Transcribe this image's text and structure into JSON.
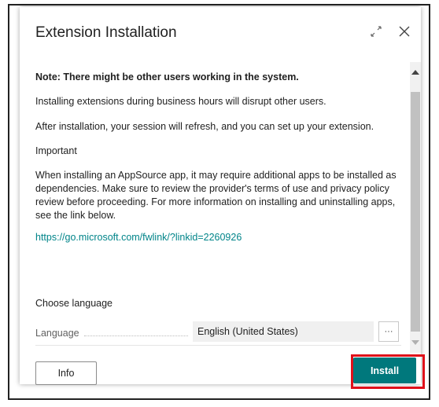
{
  "dialog": {
    "title": "Extension Installation",
    "expand_icon": "expand-icon",
    "close_icon": "close-icon"
  },
  "content": {
    "note_heading": "Note: There might be other users working in the system.",
    "paragraph_1": "Installing extensions during business hours will disrupt other users.",
    "paragraph_2": "After installation, your session will refresh, and you can set up your extension.",
    "important_heading": "Important",
    "paragraph_3": "When installing an AppSource app, it may require additional apps to be installed as dependencies. Make sure to review the provider's terms of use and privacy policy review before proceeding. For more information on installing and uninstalling apps, see the link below.",
    "link": "https://go.microsoft.com/fwlink/?linkid=2260926",
    "choose_language": "Choose language",
    "language_label": "Language",
    "language_value": "English (United States)",
    "lookup_label": "···"
  },
  "footer": {
    "info_label": "Info",
    "install_label": "Install"
  },
  "colors": {
    "accent": "#00787c",
    "link": "#008489",
    "highlight": "#e0101a"
  }
}
